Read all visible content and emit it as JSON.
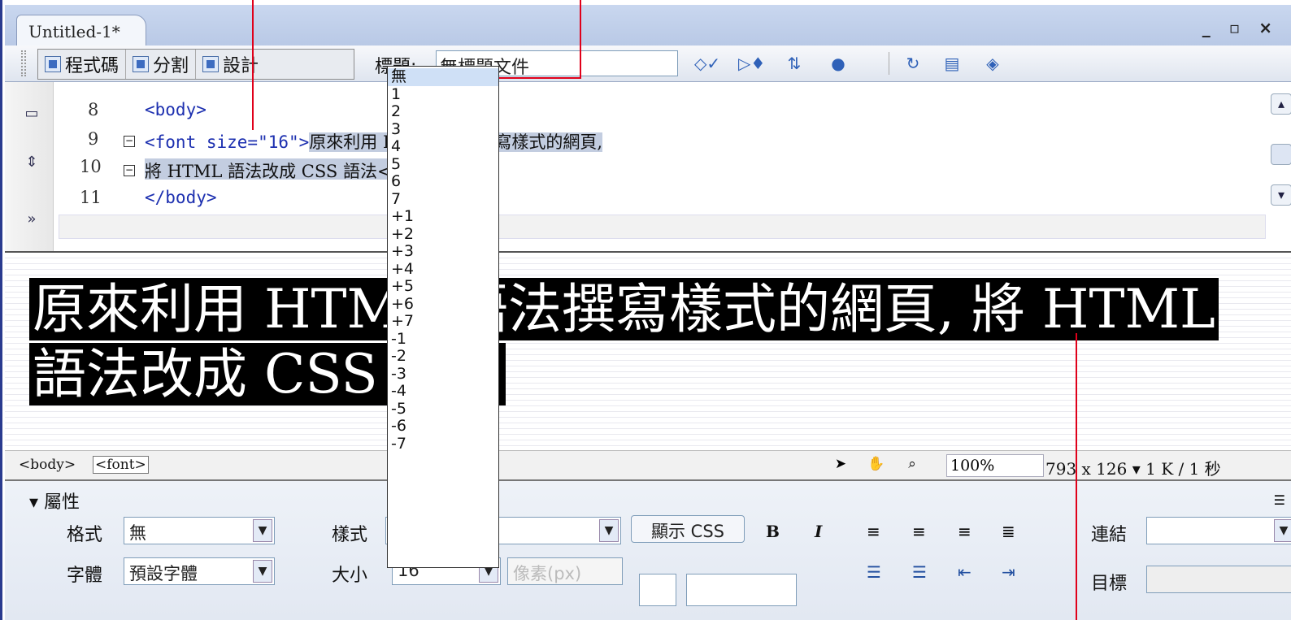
{
  "document": {
    "tab": "Untitled-1*",
    "window_controls": "_ ▫ ×"
  },
  "toolbar": {
    "code_label": "程式碼",
    "split_label": "分割",
    "design_label": "設計",
    "title_label": "標題:",
    "title_value": "無標題文件"
  },
  "code": {
    "lines": [
      {
        "num": "8",
        "text": "<body>"
      },
      {
        "num": "9",
        "tag": "<font size=\"16\">",
        "text": "原來利用 HTML 語法撰寫樣式的網頁,"
      },
      {
        "num": "10",
        "text": "將 HTML 語法改成 CSS 語法</font>"
      },
      {
        "num": "11",
        "text": "</body>"
      }
    ]
  },
  "design": {
    "text": "原來利用 HTML 語法撰寫樣式的網頁, 將 HTML 語法改成 CSS 語法"
  },
  "status": {
    "tags": [
      "<body>",
      "<font>"
    ],
    "zoom": "100%",
    "dimensions": "793 x 126",
    "filesize": "1 K / 1 秒"
  },
  "properties": {
    "header": "屬性",
    "format_label": "格式",
    "format_value": "無",
    "font_label": "字體",
    "font_value": "預設字體",
    "style_label": "樣式",
    "size_label": "大小",
    "size_value": "16",
    "unit_value": "像素(px)",
    "show_css": "顯示 CSS",
    "bold": "B",
    "italic": "I",
    "link_label": "連結",
    "target_label": "目標"
  },
  "dropdown": {
    "options": [
      "無",
      "1",
      "2",
      "3",
      "4",
      "5",
      "6",
      "7",
      "+1",
      "+2",
      "+3",
      "+4",
      "+5",
      "+6",
      "+7",
      "-1",
      "-2",
      "-3",
      "-4",
      "-5",
      "-6",
      "-7"
    ]
  },
  "colors": {
    "selection": "#c3cde0",
    "annotation": "#e0001a",
    "design_bg": "#000000"
  }
}
